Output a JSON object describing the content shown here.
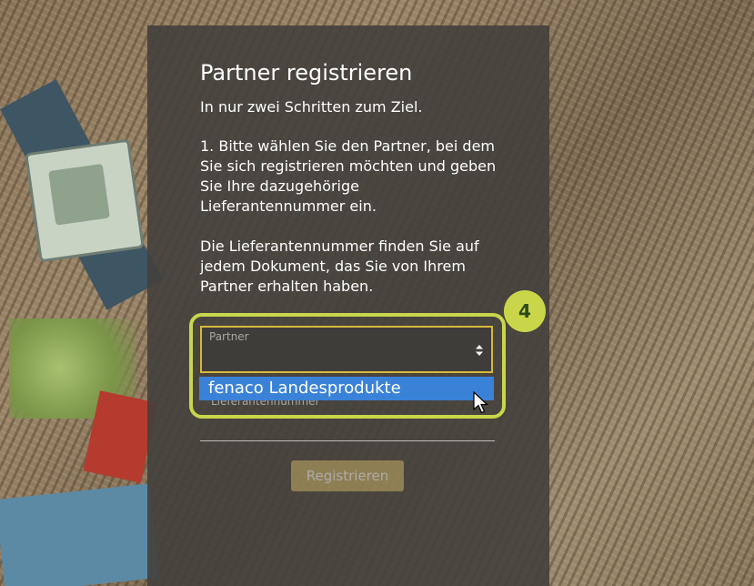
{
  "form": {
    "title": "Partner registrieren",
    "subtitle": "In nur zwei Schritten zum Ziel.",
    "instruction_1": "1. Bitte wählen Sie den Partner, bei dem Sie sich registrieren möchten und geben Sie Ihre dazugehörige Lieferantennummer ein.",
    "instruction_2": "Die Lieferantennummer finden Sie auf jedem Dokument, das Sie von Ihrem Partner erhalten haben.",
    "partner_label": "Partner",
    "partner_option": "fenaco Landesprodukte",
    "supplier_label": "Lieferantennummer",
    "register_label": "Registrieren"
  },
  "annotation": {
    "step_number": "4",
    "color": "#c9d64a"
  },
  "colors": {
    "panel": "#42403c",
    "accent": "#d7b83a",
    "option_highlight": "#3a82d8",
    "button": "#c8ae66"
  },
  "icons": {
    "select_arrow": "sort-arrows-icon",
    "pointer": "mouse-pointer-icon"
  }
}
